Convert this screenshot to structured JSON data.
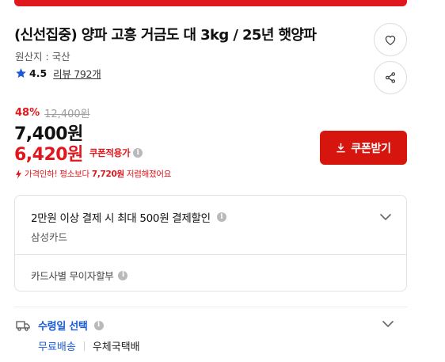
{
  "product": {
    "title": "(신선집중) 양파 고흥 거금도 대 3kg / 25년 햇양파",
    "origin": "원산지 : 국산",
    "rating": "4.5",
    "review_count": "리뷰 792개"
  },
  "price": {
    "discount_rate": "48%",
    "original": "12,400원",
    "sale": "7,400원",
    "coupon_price": "6,420원",
    "coupon_label": "쿠폰적용가",
    "drop_prefix": "가격인하! 평소보다",
    "drop_amount": "7,720원",
    "drop_suffix": "저렴해졌어요"
  },
  "buttons": {
    "coupon": "쿠폰받기"
  },
  "card_benefit": {
    "title": "2만원 이상 결제 시 최대 500원 결제할인",
    "card_name": "삼성카드",
    "installment": "카드사별 무이자할부"
  },
  "delivery": {
    "title": "수령일 선택",
    "free_shipping": "무료배송",
    "carrier": "우체국택배"
  },
  "colors": {
    "accent": "#e0171d",
    "link_blue": "#1a5ad7"
  },
  "icons": {
    "info": "i"
  }
}
